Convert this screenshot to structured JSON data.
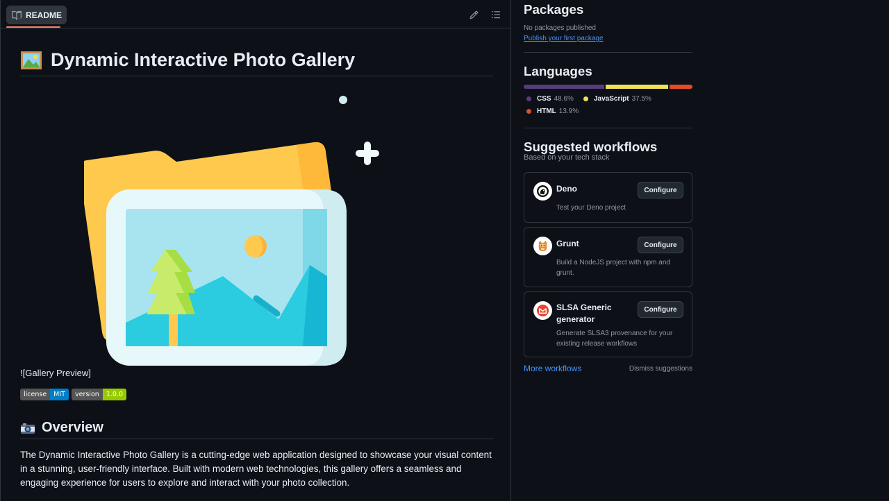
{
  "readme": {
    "tab_label": "README",
    "title": "Dynamic Interactive Photo Gallery",
    "image_alt_text": "![Gallery Preview]",
    "badges": [
      {
        "label": "license",
        "value": "MIT",
        "color": "#007ec6"
      },
      {
        "label": "version",
        "value": "1.0.0",
        "color": "#97ca00"
      }
    ],
    "overview_heading": "Overview",
    "overview_text": "The Dynamic Interactive Photo Gallery is a cutting-edge web application designed to showcase your visual content in a stunning, user-friendly interface. Built with modern web technologies, this gallery offers a seamless and engaging experience for users to explore and interact with your photo collection."
  },
  "packages": {
    "heading": "Packages",
    "empty_text": "No packages published",
    "publish_link": "Publish your first package"
  },
  "languages": {
    "heading": "Languages",
    "items": [
      {
        "name": "CSS",
        "percent": "48.6%",
        "value": 48.6,
        "color": "#563d7c"
      },
      {
        "name": "JavaScript",
        "percent": "37.5%",
        "value": 37.5,
        "color": "#f1e05a"
      },
      {
        "name": "HTML",
        "percent": "13.9%",
        "value": 13.9,
        "color": "#e34c26"
      }
    ]
  },
  "workflows": {
    "heading": "Suggested workflows",
    "subheading": "Based on your tech stack",
    "configure_label": "Configure",
    "items": [
      {
        "name": "Deno",
        "description": "Test your Deno project",
        "icon": "deno-icon"
      },
      {
        "name": "Grunt",
        "description": "Build a NodeJS project with npm and grunt.",
        "icon": "grunt-icon"
      },
      {
        "name": "SLSA Generic generator",
        "description": "Generate SLSA3 provenance for your existing release workflows",
        "icon": "slsa-icon"
      }
    ],
    "more_link": "More workflows",
    "dismiss_label": "Dismiss suggestions"
  }
}
